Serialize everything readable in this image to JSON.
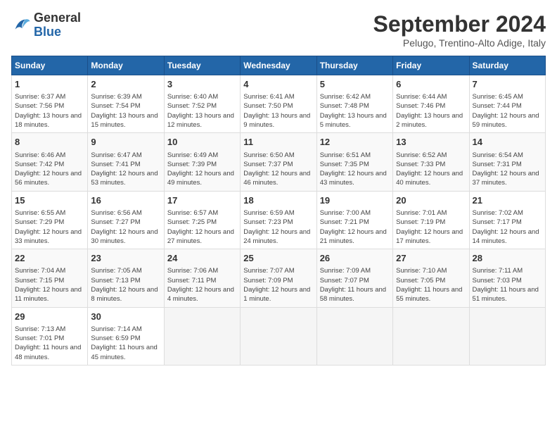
{
  "logo": {
    "general": "General",
    "blue": "Blue"
  },
  "title": "September 2024",
  "location": "Pelugo, Trentino-Alto Adige, Italy",
  "days_header": [
    "Sunday",
    "Monday",
    "Tuesday",
    "Wednesday",
    "Thursday",
    "Friday",
    "Saturday"
  ],
  "weeks": [
    [
      {
        "num": "1",
        "info": "Sunrise: 6:37 AM\nSunset: 7:56 PM\nDaylight: 13 hours and 18 minutes."
      },
      {
        "num": "2",
        "info": "Sunrise: 6:39 AM\nSunset: 7:54 PM\nDaylight: 13 hours and 15 minutes."
      },
      {
        "num": "3",
        "info": "Sunrise: 6:40 AM\nSunset: 7:52 PM\nDaylight: 13 hours and 12 minutes."
      },
      {
        "num": "4",
        "info": "Sunrise: 6:41 AM\nSunset: 7:50 PM\nDaylight: 13 hours and 9 minutes."
      },
      {
        "num": "5",
        "info": "Sunrise: 6:42 AM\nSunset: 7:48 PM\nDaylight: 13 hours and 5 minutes."
      },
      {
        "num": "6",
        "info": "Sunrise: 6:44 AM\nSunset: 7:46 PM\nDaylight: 13 hours and 2 minutes."
      },
      {
        "num": "7",
        "info": "Sunrise: 6:45 AM\nSunset: 7:44 PM\nDaylight: 12 hours and 59 minutes."
      }
    ],
    [
      {
        "num": "8",
        "info": "Sunrise: 6:46 AM\nSunset: 7:42 PM\nDaylight: 12 hours and 56 minutes."
      },
      {
        "num": "9",
        "info": "Sunrise: 6:47 AM\nSunset: 7:41 PM\nDaylight: 12 hours and 53 minutes."
      },
      {
        "num": "10",
        "info": "Sunrise: 6:49 AM\nSunset: 7:39 PM\nDaylight: 12 hours and 49 minutes."
      },
      {
        "num": "11",
        "info": "Sunrise: 6:50 AM\nSunset: 7:37 PM\nDaylight: 12 hours and 46 minutes."
      },
      {
        "num": "12",
        "info": "Sunrise: 6:51 AM\nSunset: 7:35 PM\nDaylight: 12 hours and 43 minutes."
      },
      {
        "num": "13",
        "info": "Sunrise: 6:52 AM\nSunset: 7:33 PM\nDaylight: 12 hours and 40 minutes."
      },
      {
        "num": "14",
        "info": "Sunrise: 6:54 AM\nSunset: 7:31 PM\nDaylight: 12 hours and 37 minutes."
      }
    ],
    [
      {
        "num": "15",
        "info": "Sunrise: 6:55 AM\nSunset: 7:29 PM\nDaylight: 12 hours and 33 minutes."
      },
      {
        "num": "16",
        "info": "Sunrise: 6:56 AM\nSunset: 7:27 PM\nDaylight: 12 hours and 30 minutes."
      },
      {
        "num": "17",
        "info": "Sunrise: 6:57 AM\nSunset: 7:25 PM\nDaylight: 12 hours and 27 minutes."
      },
      {
        "num": "18",
        "info": "Sunrise: 6:59 AM\nSunset: 7:23 PM\nDaylight: 12 hours and 24 minutes."
      },
      {
        "num": "19",
        "info": "Sunrise: 7:00 AM\nSunset: 7:21 PM\nDaylight: 12 hours and 21 minutes."
      },
      {
        "num": "20",
        "info": "Sunrise: 7:01 AM\nSunset: 7:19 PM\nDaylight: 12 hours and 17 minutes."
      },
      {
        "num": "21",
        "info": "Sunrise: 7:02 AM\nSunset: 7:17 PM\nDaylight: 12 hours and 14 minutes."
      }
    ],
    [
      {
        "num": "22",
        "info": "Sunrise: 7:04 AM\nSunset: 7:15 PM\nDaylight: 12 hours and 11 minutes."
      },
      {
        "num": "23",
        "info": "Sunrise: 7:05 AM\nSunset: 7:13 PM\nDaylight: 12 hours and 8 minutes."
      },
      {
        "num": "24",
        "info": "Sunrise: 7:06 AM\nSunset: 7:11 PM\nDaylight: 12 hours and 4 minutes."
      },
      {
        "num": "25",
        "info": "Sunrise: 7:07 AM\nSunset: 7:09 PM\nDaylight: 12 hours and 1 minute."
      },
      {
        "num": "26",
        "info": "Sunrise: 7:09 AM\nSunset: 7:07 PM\nDaylight: 11 hours and 58 minutes."
      },
      {
        "num": "27",
        "info": "Sunrise: 7:10 AM\nSunset: 7:05 PM\nDaylight: 11 hours and 55 minutes."
      },
      {
        "num": "28",
        "info": "Sunrise: 7:11 AM\nSunset: 7:03 PM\nDaylight: 11 hours and 51 minutes."
      }
    ],
    [
      {
        "num": "29",
        "info": "Sunrise: 7:13 AM\nSunset: 7:01 PM\nDaylight: 11 hours and 48 minutes."
      },
      {
        "num": "30",
        "info": "Sunrise: 7:14 AM\nSunset: 6:59 PM\nDaylight: 11 hours and 45 minutes."
      },
      {
        "num": "",
        "info": ""
      },
      {
        "num": "",
        "info": ""
      },
      {
        "num": "",
        "info": ""
      },
      {
        "num": "",
        "info": ""
      },
      {
        "num": "",
        "info": ""
      }
    ]
  ]
}
